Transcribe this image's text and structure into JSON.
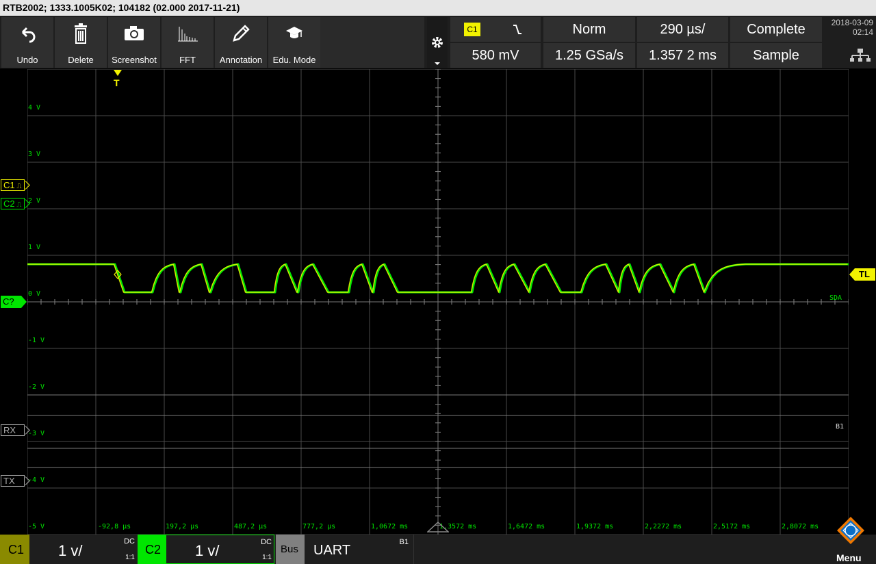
{
  "title": "RTB2002; 1333.1005K02; 104182 (02.000 2017-11-21)",
  "toolbar": {
    "undo": "Undo",
    "delete": "Delete",
    "screenshot": "Screenshot",
    "fft": "FFT",
    "annotation": "Annotation",
    "edu_mode": "Edu. Mode"
  },
  "trigger": {
    "source": "C1",
    "slope_icon": "falling-edge-icon",
    "mode": "Norm",
    "level": "580 mV",
    "horizontal_position": "1.357 2 ms",
    "trigger_marker": "T",
    "level_marker": "TL"
  },
  "acquisition": {
    "time_per_div": "290 µs/",
    "sample_rate": "1.25 GSa/s",
    "status": "Complete",
    "mode": "Sample"
  },
  "datetime": {
    "date": "2018-03-09",
    "time": "02:14"
  },
  "y_axis_labels": [
    "4 V",
    "3 V",
    "2 V",
    "1 V",
    "0 V",
    "-1 V",
    "-2 V",
    "-3 V",
    "-4 V",
    "-5 V"
  ],
  "x_axis_labels": [
    "-92,8 µs",
    "197,2 µs",
    "487,2 µs",
    "777,2 µs",
    "1,0672 ms",
    "1,3572 ms",
    "1,6472 ms",
    "1,9372 ms",
    "2,2272 ms",
    "2,5172 ms",
    "2,8072 ms"
  ],
  "channel_markers": {
    "c1": "C1",
    "c2": "C2",
    "ground": "C?",
    "rx": "RX",
    "tx": "TX"
  },
  "trace_labels": {
    "sda": "SDA",
    "bus": "B1"
  },
  "bottom": {
    "c1_label": "C1",
    "c1_scale": "1 v/",
    "c1_coupling": "DC",
    "c1_probe": "1:1",
    "c2_label": "C2",
    "c2_scale": "1 v/",
    "c2_coupling": "DC",
    "c2_probe": "1:1",
    "bus_label": "Bus",
    "bus_protocol": "UART",
    "bus_id": "B1",
    "menu_label": "Menu"
  },
  "colors": {
    "c1": "#f2f200",
    "c2": "#00e600",
    "grid": "#4a4a4a",
    "bus": "#808080"
  }
}
